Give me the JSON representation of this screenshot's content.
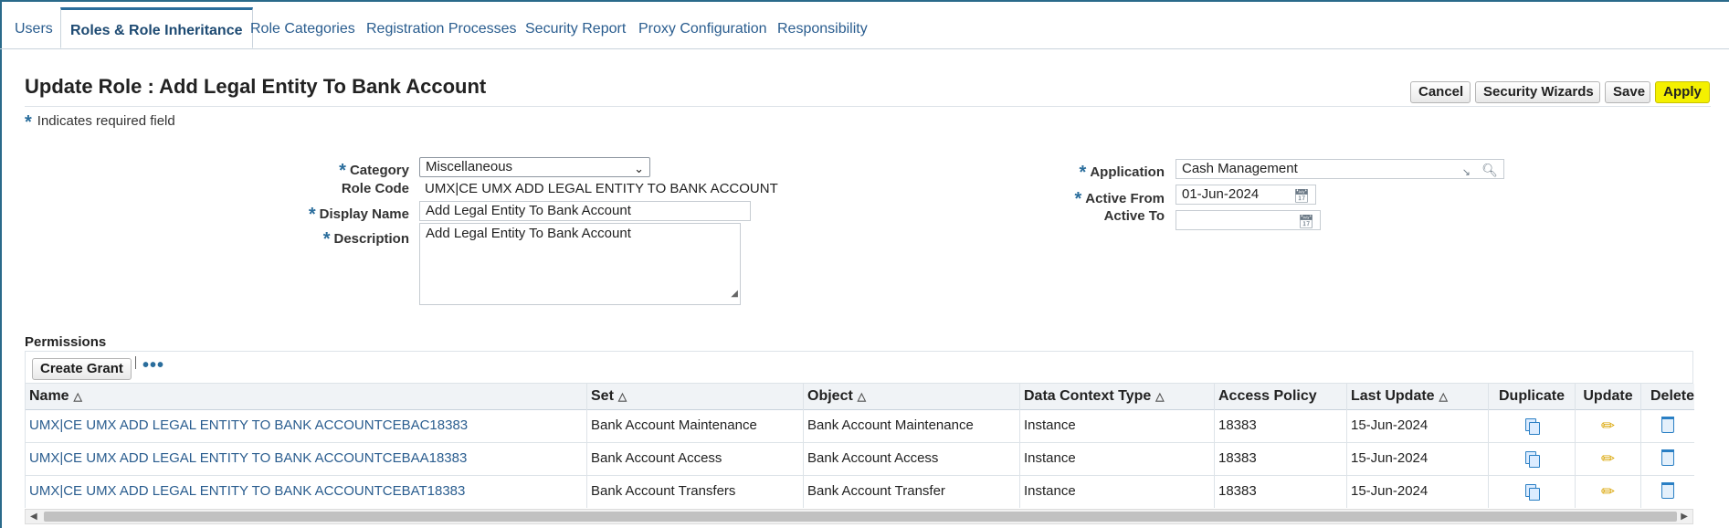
{
  "tabs": [
    {
      "label": "Users"
    },
    {
      "label": "Roles & Role Inheritance",
      "active": true
    },
    {
      "label": "Role Categories"
    },
    {
      "label": "Registration Processes"
    },
    {
      "label": "Security Report"
    },
    {
      "label": "Proxy Configuration"
    },
    {
      "label": "Responsibility"
    }
  ],
  "header": {
    "title": "Update Role : Add Legal Entity To Bank Account",
    "required_note": "Indicates required field",
    "required_star": "*",
    "buttons": {
      "cancel": "Cancel",
      "wizards": "Security Wizards",
      "save": "Save",
      "apply": "Apply"
    }
  },
  "form": {
    "category": {
      "label": "Category",
      "value": "Miscellaneous"
    },
    "role_code": {
      "label": "Role Code",
      "value": "UMX|CE UMX ADD LEGAL ENTITY TO BANK ACCOUNT"
    },
    "display_name": {
      "label": "Display Name",
      "value": "Add Legal Entity To Bank Account"
    },
    "description": {
      "label": "Description",
      "value": "Add Legal Entity To Bank Account"
    },
    "application": {
      "label": "Application",
      "value": "Cash Management"
    },
    "active_from": {
      "label": "Active From",
      "value": "01-Jun-2024"
    },
    "active_to": {
      "label": "Active To",
      "value": ""
    }
  },
  "permissions": {
    "title": "Permissions",
    "create_grant": "Create Grant",
    "more": "•••",
    "columns": [
      "Name",
      "Set",
      "Object",
      "Data Context Type",
      "Access Policy",
      "Last Update",
      "Duplicate",
      "Update",
      "Delete"
    ],
    "rows": [
      {
        "name": "UMX|CE UMX ADD LEGAL ENTITY TO BANK ACCOUNTCEBAC18383",
        "set": "Bank Account Maintenance",
        "object": "Bank Account Maintenance",
        "context": "Instance",
        "policy": "18383",
        "updated": "15-Jun-2024"
      },
      {
        "name": "UMX|CE UMX ADD LEGAL ENTITY TO BANK ACCOUNTCEBAA18383",
        "set": "Bank Account Access",
        "object": "Bank Account Access",
        "context": "Instance",
        "policy": "18383",
        "updated": "15-Jun-2024"
      },
      {
        "name": "UMX|CE UMX ADD LEGAL ENTITY TO BANK ACCOUNTCEBAT18383",
        "set": "Bank Account Transfers",
        "object": "Bank Account Transfer",
        "context": "Instance",
        "policy": "18383",
        "updated": "15-Jun-2024"
      }
    ]
  },
  "icons": {
    "sort": "sort-ascending-icon",
    "duplicate": "duplicate-icon",
    "update": "pencil-icon",
    "delete": "trash-icon",
    "search": "search-icon",
    "calendar": "calendar-icon"
  },
  "colors": {
    "link": "#2a5d8f",
    "apply_button": "#f4f000",
    "required": "#2a6d9c"
  }
}
